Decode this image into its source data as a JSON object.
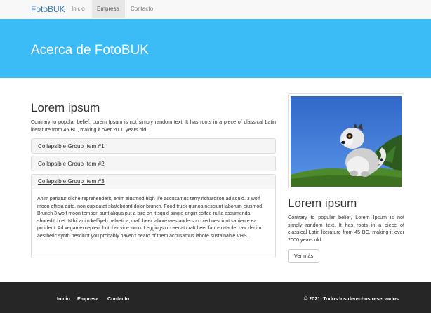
{
  "navbar": {
    "brand": "FotoBUK",
    "items": [
      {
        "label": "Inicio",
        "active": false
      },
      {
        "label": "Empresa",
        "active": true
      },
      {
        "label": "Contacto",
        "active": false
      }
    ]
  },
  "hero": {
    "title": "Acerca de FotoBUK"
  },
  "main": {
    "heading": "Lorem ipsum",
    "intro": "Contrary to popular belief, Lorem Ipsum is not simply random text. It has roots in a piece of classical Latin literature from 45 BC, making it over 2000 years old.",
    "accordion": [
      {
        "title": "Collapsible Group Item #1",
        "expanded": false
      },
      {
        "title": "Collapsible Group Item #2",
        "expanded": false
      },
      {
        "title": "Collapsible Group Item #3",
        "expanded": true
      }
    ],
    "accordion_body": "Anim pariatur cliche reprehenderit, enim eiusmod high life accusamus terry richardson ad squid. 3 wolf moon officia aute, non cupidatat skateboard dolor brunch. Food truck quinoa nesciunt laborum eiusmod. Brunch 3 wolf moon tempor, sunt aliqua put a bird on it squid single-origin coffee nulla assumenda shoreditch et. Nihil anim keffiyeh helvetica, craft beer labore wes anderson cred nesciunt sapiente ea proident. Ad vegan excepteur butcher vice lomo. Leggings occaecat craft beer farm-to-table, raw denim aesthetic synth nesciunt you probably haven't heard of them accusamus labore sustainable VHS."
  },
  "sidebar": {
    "heading": "Lorem ipsum",
    "text": "Contrary to popular belief, Lorem Ipsum is not simply random text. It has roots in a piece of classical Latin literature from 45 BC, making it over 2000 years old.",
    "button": "Ver más"
  },
  "footer": {
    "links": [
      "Inicio",
      "Empresa",
      "Contacto"
    ],
    "copyright": "© 2021, Todos los derechos reservados"
  },
  "colors": {
    "hero": "#3bbcf7",
    "footer": "#262626",
    "brand": "#337ab7"
  }
}
